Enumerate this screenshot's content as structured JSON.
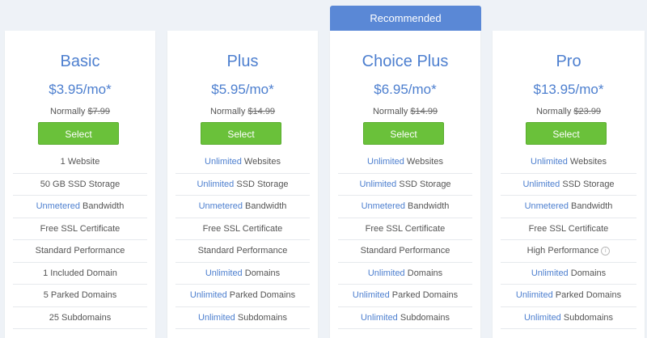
{
  "recommended_label": "Recommended",
  "colors": {
    "accent": "#4d7fcf",
    "button": "#6ac13a",
    "banner": "#5a88d6"
  },
  "plans": [
    {
      "name": "Basic",
      "price": "$3.95/mo*",
      "normally_label": "Normally",
      "normally_price": "$7.99",
      "button": "Select",
      "features": [
        {
          "highlight": "",
          "text": "1 Website"
        },
        {
          "highlight": "",
          "text": "50 GB SSD Storage"
        },
        {
          "highlight": "Unmetered",
          "text": " Bandwidth"
        },
        {
          "highlight": "",
          "text": "Free SSL Certificate"
        },
        {
          "highlight": "",
          "text": "Standard Performance"
        },
        {
          "highlight": "",
          "text": "1 Included Domain"
        },
        {
          "highlight": "",
          "text": "5 Parked Domains"
        },
        {
          "highlight": "",
          "text": "25 Subdomains"
        }
      ]
    },
    {
      "name": "Plus",
      "price": "$5.95/mo*",
      "normally_label": "Normally",
      "normally_price": "$14.99",
      "button": "Select",
      "features": [
        {
          "highlight": "Unlimited",
          "text": " Websites"
        },
        {
          "highlight": "Unlimited",
          "text": " SSD Storage"
        },
        {
          "highlight": "Unmetered",
          "text": " Bandwidth"
        },
        {
          "highlight": "",
          "text": "Free SSL Certificate"
        },
        {
          "highlight": "",
          "text": "Standard Performance"
        },
        {
          "highlight": "Unlimited",
          "text": " Domains"
        },
        {
          "highlight": "Unlimited",
          "text": " Parked Domains"
        },
        {
          "highlight": "Unlimited",
          "text": " Subdomains"
        }
      ]
    },
    {
      "name": "Choice Plus",
      "price": "$6.95/mo*",
      "normally_label": "Normally",
      "normally_price": "$14.99",
      "button": "Select",
      "features": [
        {
          "highlight": "Unlimited",
          "text": " Websites"
        },
        {
          "highlight": "Unlimited",
          "text": " SSD Storage"
        },
        {
          "highlight": "Unmetered",
          "text": " Bandwidth"
        },
        {
          "highlight": "",
          "text": "Free SSL Certificate"
        },
        {
          "highlight": "",
          "text": "Standard Performance"
        },
        {
          "highlight": "Unlimited",
          "text": " Domains"
        },
        {
          "highlight": "Unlimited",
          "text": " Parked Domains"
        },
        {
          "highlight": "Unlimited",
          "text": " Subdomains"
        }
      ]
    },
    {
      "name": "Pro",
      "price": "$13.95/mo*",
      "normally_label": "Normally",
      "normally_price": "$23.99",
      "button": "Select",
      "features": [
        {
          "highlight": "Unlimited",
          "text": " Websites"
        },
        {
          "highlight": "Unlimited",
          "text": " SSD Storage"
        },
        {
          "highlight": "Unmetered",
          "text": " Bandwidth"
        },
        {
          "highlight": "",
          "text": "Free SSL Certificate"
        },
        {
          "highlight": "",
          "text": "High Performance",
          "info_icon": "info-icon"
        },
        {
          "highlight": "Unlimited",
          "text": " Domains"
        },
        {
          "highlight": "Unlimited",
          "text": " Parked Domains"
        },
        {
          "highlight": "Unlimited",
          "text": " Subdomains"
        }
      ]
    }
  ]
}
